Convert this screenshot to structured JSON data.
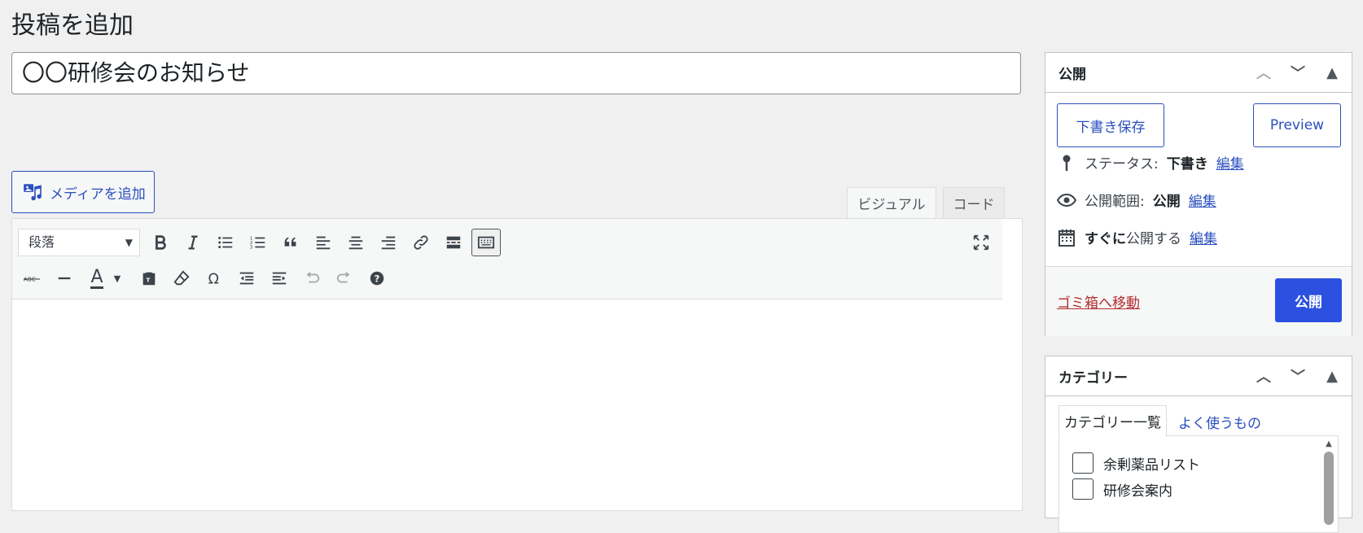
{
  "page": {
    "title": "投稿を追加"
  },
  "post": {
    "title_value": "〇〇研修会のお知らせ"
  },
  "media": {
    "add_label": "メディアを追加"
  },
  "editor": {
    "tabs": {
      "visual": "ビジュアル",
      "code": "コード"
    },
    "format_select": "段落",
    "text_color_letter": "A"
  },
  "publish_box": {
    "title": "公開",
    "save_draft": "下書き保存",
    "preview": "Preview",
    "status_label": "ステータス:",
    "status_value": "下書き",
    "visibility_label": "公開範囲:",
    "visibility_value": "公開",
    "schedule_value": "すぐに",
    "schedule_label": "公開する",
    "edit_link": "編集",
    "trash": "ゴミ箱へ移動",
    "publish": "公開"
  },
  "category_box": {
    "title": "カテゴリー",
    "tab_all": "カテゴリー一覧",
    "tab_popular": "よく使うもの",
    "items": [
      "余剰薬品リスト",
      "研修会案内"
    ]
  },
  "colors": {
    "accent": "#2c50e0",
    "link": "#2a4fbf",
    "danger": "#b32d2e",
    "background": "#f0f0f1"
  }
}
